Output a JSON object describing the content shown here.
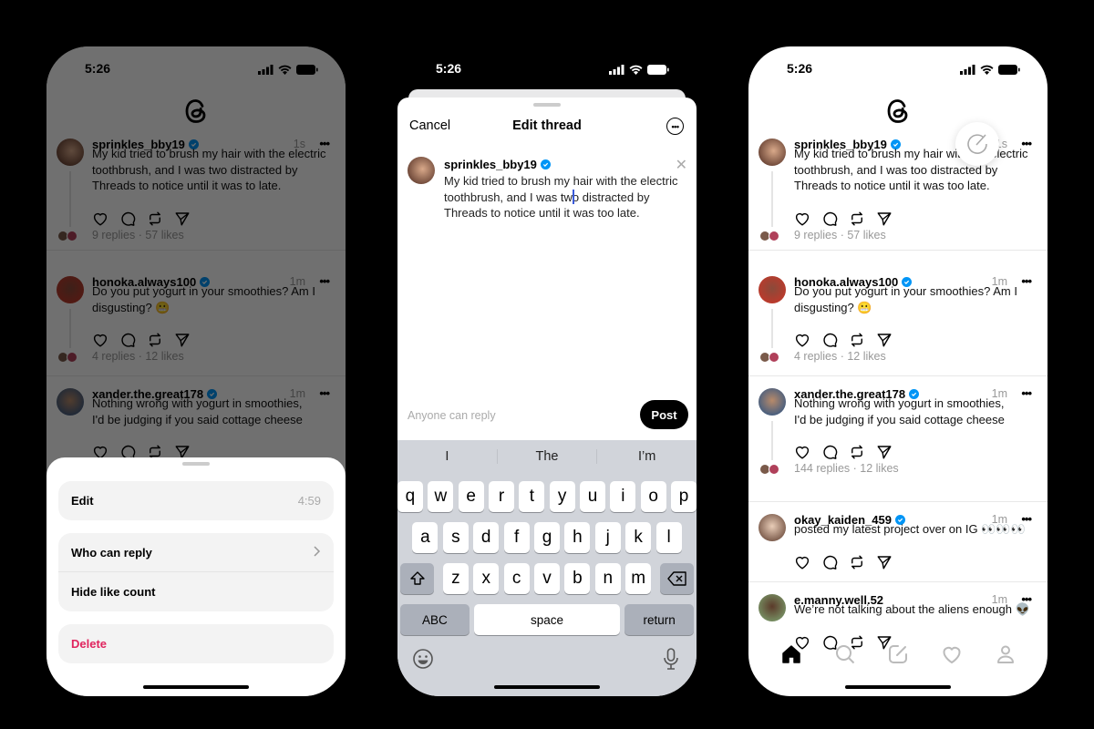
{
  "left_phone": {
    "status_time": "5:26",
    "feed": {
      "posts": [
        {
          "user": "sprinkles_bby19",
          "verified": true,
          "time": "1s",
          "text": "My kid tried to brush my hair with the electric\ntoothbrush, and I was two distracted by\nThreads to notice until it was to late.",
          "replies": "9 replies",
          "likes": "57 likes"
        },
        {
          "user": "honoka.always100",
          "verified": true,
          "time": "1m",
          "text": "Do you put yogurt in your smoothies? Am I\ndisgusting? 😬",
          "replies": "4 replies",
          "likes": "12 likes"
        },
        {
          "user": "xander.the.great178",
          "verified": true,
          "time": "1m",
          "text": "Nothing wrong with yogurt in smoothies,\nI'd be judging if you said cottage cheese"
        }
      ]
    },
    "sheet": {
      "edit_label": "Edit",
      "edit_timer": "4:59",
      "who_can_reply_label": "Who can reply",
      "hide_like_count_label": "Hide like count",
      "delete_label": "Delete",
      "delete_color": "#e0245e"
    }
  },
  "middle_phone": {
    "status_time": "5:26",
    "header": {
      "cancel_label": "Cancel",
      "title": "Edit thread"
    },
    "draft": {
      "user": "sprinkles_bby19",
      "text": "My kid tried to brush my hair with the electric\ntoothbrush, and I was two distracted by\nThreads to notice until it was too late."
    },
    "reply_setting": "Anyone can reply",
    "post_label": "Post",
    "keyboard": {
      "suggestions": [
        "I",
        "The",
        "I’m"
      ],
      "row1": [
        "q",
        "w",
        "e",
        "r",
        "t",
        "y",
        "u",
        "i",
        "o",
        "p"
      ],
      "row2": [
        "a",
        "s",
        "d",
        "f",
        "g",
        "h",
        "j",
        "k",
        "l"
      ],
      "row3": [
        "z",
        "x",
        "c",
        "v",
        "b",
        "n",
        "m"
      ],
      "abc_label": "ABC",
      "space_label": "space",
      "return_label": "return"
    }
  },
  "right_phone": {
    "status_time": "5:26",
    "feed": {
      "posts": [
        {
          "user": "sprinkles_bby19",
          "verified": true,
          "time": "1s",
          "text": "My kid tried to brush my hair with the electric\ntoothbrush, and I was too distracted by\nThreads to notice until it was too late.",
          "replies": "9 replies",
          "likes": "57 likes"
        },
        {
          "user": "honoka.always100",
          "verified": true,
          "time": "1m",
          "text": "Do you put yogurt in your smoothies? Am I\ndisgusting? 😬",
          "replies": "4 replies",
          "likes": "12 likes"
        },
        {
          "user": "xander.the.great178",
          "verified": true,
          "time": "1m",
          "text": "Nothing wrong with yogurt in smoothies,\nI'd be judging if you said cottage cheese",
          "replies": "144 replies",
          "likes": "12 likes"
        },
        {
          "user": "okay_kaiden_459",
          "verified": true,
          "time": "1m",
          "text": "posted my latest project over on IG 👀👀👀"
        },
        {
          "user": "e.manny.well.52",
          "verified": false,
          "time": "1m",
          "text": "We’re not talking about the aliens enough 👽"
        }
      ]
    },
    "tabs": [
      "home-icon",
      "search-icon",
      "compose-icon",
      "heart-icon",
      "profile-icon"
    ],
    "accent": "#0095f6"
  }
}
